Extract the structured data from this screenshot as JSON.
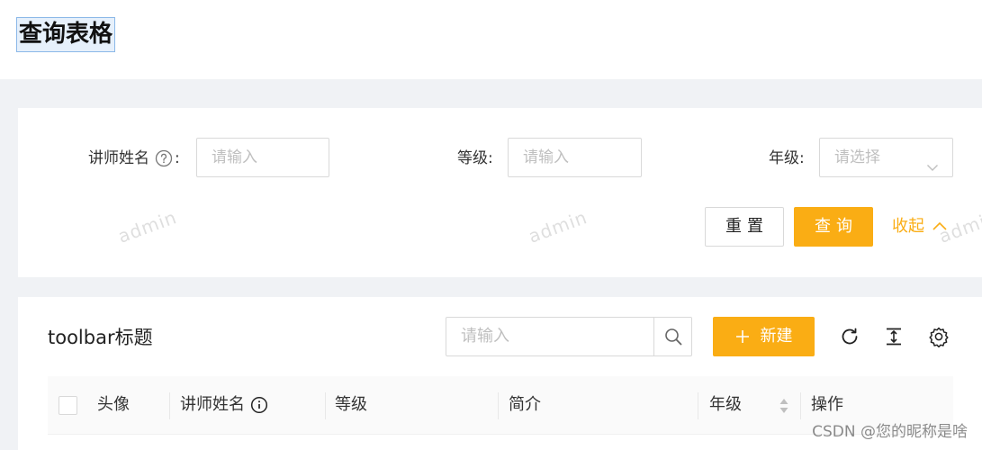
{
  "page": {
    "title": "查询表格"
  },
  "filter": {
    "teacher_name_label": "讲师姓名",
    "teacher_name_colon": ":",
    "teacher_name_placeholder": "请输入",
    "level_label": "等级:",
    "level_placeholder": "请输入",
    "grade_label": "年级:",
    "grade_placeholder": "请选择",
    "reset_label": "重置",
    "query_label": "查询",
    "collapse_label": "收起"
  },
  "watermark": {
    "text": "admin"
  },
  "toolbar": {
    "title": "toolbar标题",
    "search_placeholder": "请输入",
    "new_label": "新建"
  },
  "table": {
    "columns": [
      "头像",
      "讲师姓名",
      "等级",
      "简介",
      "年级",
      "操作"
    ]
  },
  "credit": "CSDN @您的昵称是啥",
  "colors": {
    "accent": "#faad14",
    "background": "#f0f2f5"
  },
  "icons": [
    "question-circle-icon",
    "chevron-down-icon",
    "chevron-up-icon",
    "search-icon",
    "plus-icon",
    "reload-icon",
    "column-height-icon",
    "setting-icon",
    "info-circle-icon",
    "sort-icon"
  ]
}
